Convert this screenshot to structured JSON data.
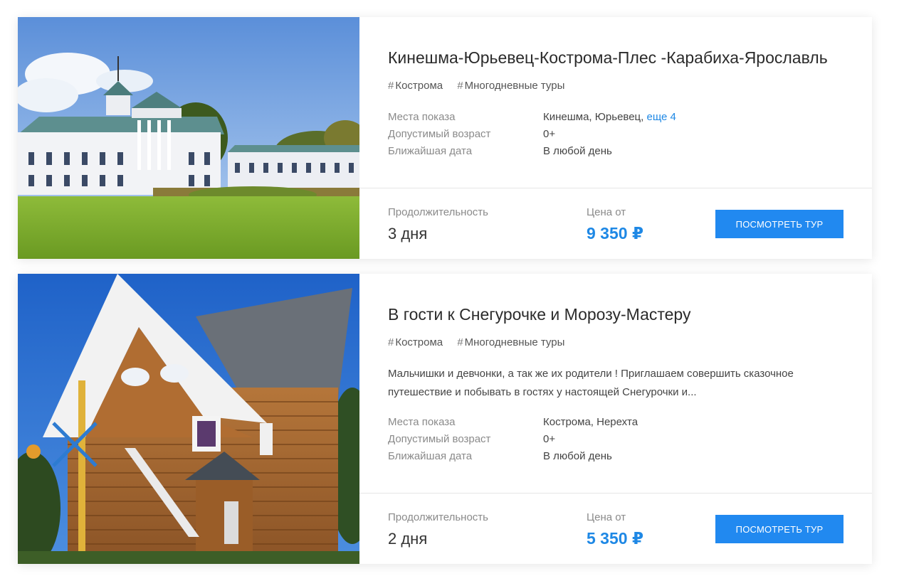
{
  "tours": [
    {
      "title": "Кинешма-Юрьевец-Кострома-Плес -Карабиха-Ярославль",
      "tags": [
        "Кострома",
        "Многодневные туры"
      ],
      "places_label": "Места показа",
      "places_value": "Кинешма, Юрьевец,",
      "places_more": "еще 4",
      "age_label": "Допустимый возраст",
      "age_value": "0+",
      "date_label": "Ближайшая дата",
      "date_value": "В любой день",
      "duration_label": "Продолжительность",
      "duration_value": "3 дня",
      "price_label": "Цена от",
      "price_value": "9 350 ₽",
      "button_label": "Посмотреть тур"
    },
    {
      "title": "В гости к Снегурочке и Морозу-Мастеру",
      "tags": [
        "Кострома",
        "Многодневные туры"
      ],
      "description": "Мальчишки и девчонки, а так же их родители ! Приглашаем совершить сказочное путешествие и побывать в гостях у настоящей Снегурочки и...",
      "places_label": "Места показа",
      "places_value": "Кострома, Нерехта",
      "age_label": "Допустимый возраст",
      "age_value": "0+",
      "date_label": "Ближайшая дата",
      "date_value": "В любой день",
      "duration_label": "Продолжительность",
      "duration_value": "2 дня",
      "price_label": "Цена от",
      "price_value": "5 350 ₽",
      "button_label": "Посмотреть тур"
    }
  ],
  "colors": {
    "accent": "#2189f0",
    "price": "#1e88e5",
    "label": "#8a8a8a"
  }
}
